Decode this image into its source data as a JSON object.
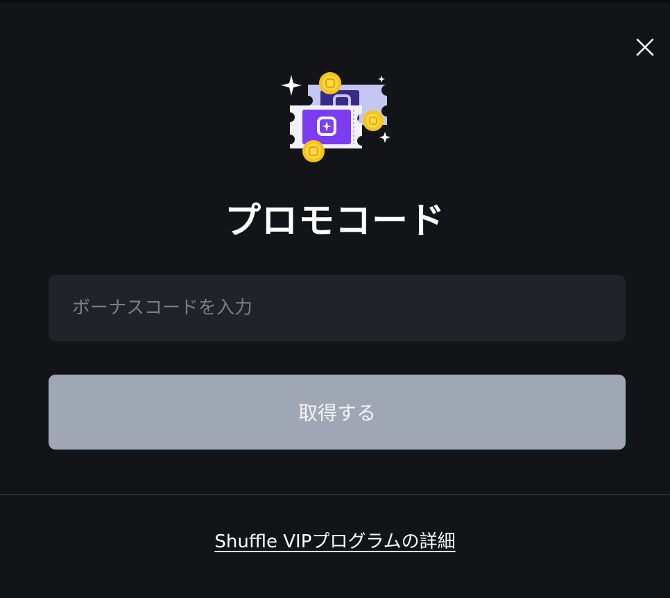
{
  "modal": {
    "title": "プロモコード",
    "close_icon": "close-icon",
    "hero_icon": "promo-tickets-illustration"
  },
  "promo_input": {
    "placeholder": "ボーナスコードを入力",
    "value": ""
  },
  "claim_button": {
    "label": "取得する"
  },
  "footer": {
    "vip_link": "Shuffle VIPプログラムの詳細"
  },
  "colors": {
    "background": "#121418",
    "input_bg": "#212328",
    "button_bg": "#9fa7b5",
    "ticket_purple": "#7b3cf2",
    "coin_gold": "#f5c518"
  }
}
